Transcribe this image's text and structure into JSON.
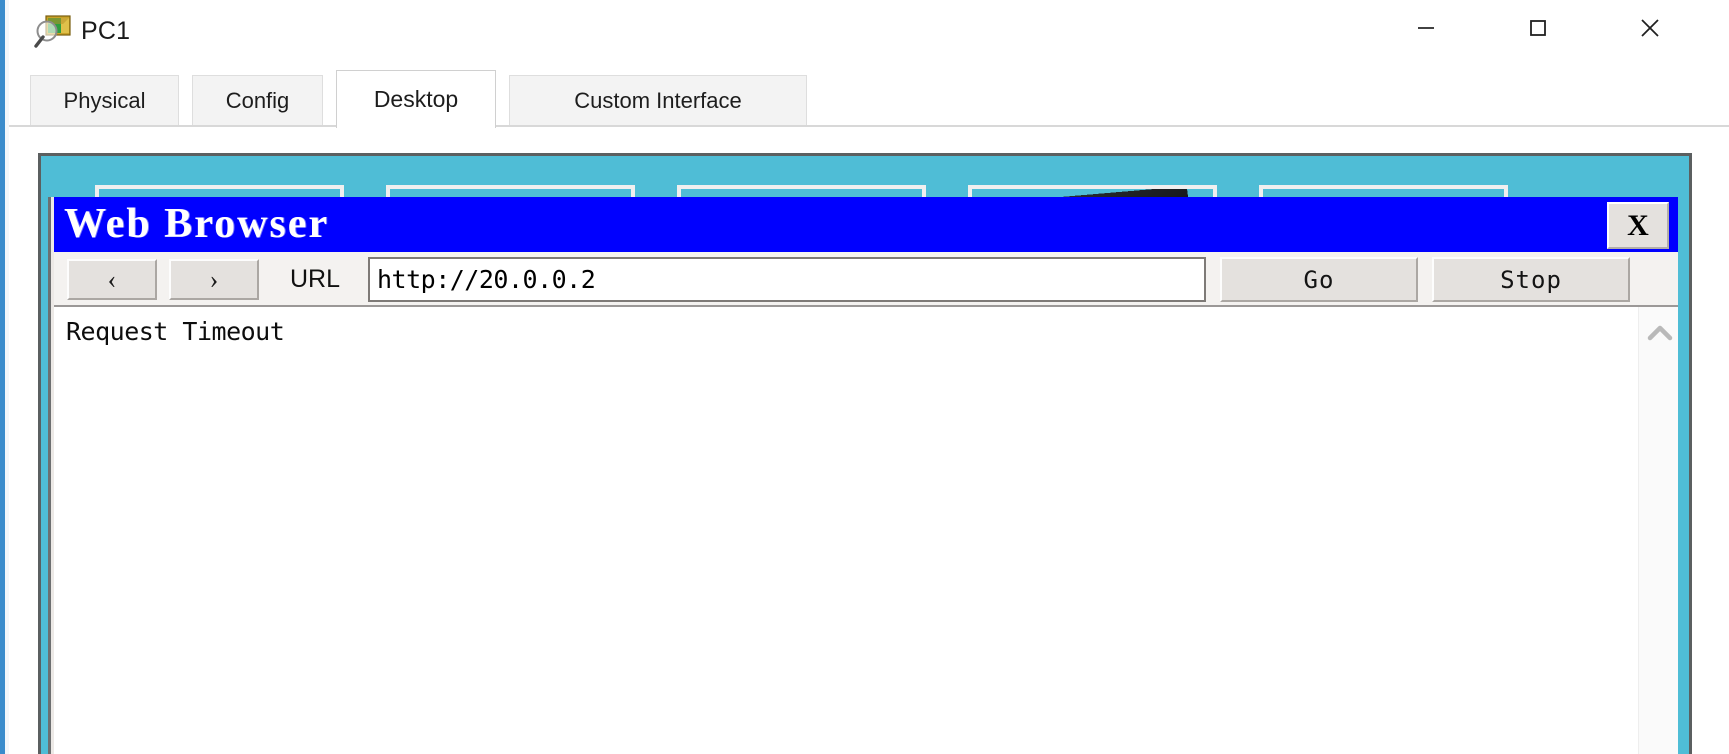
{
  "window": {
    "title": "PC1",
    "icon": "device-inspect-icon",
    "controls": {
      "minimize_label": "—",
      "minimize_icon": "minimize-icon",
      "maximize_label": "□",
      "maximize_icon": "maximize-icon",
      "close_label": "✕",
      "close_icon": "close-icon"
    }
  },
  "tabs": [
    {
      "label": "Physical",
      "active": false
    },
    {
      "label": "Config",
      "active": false
    },
    {
      "label": "Desktop",
      "active": true
    },
    {
      "label": "Custom Interface",
      "active": false
    }
  ],
  "desktop": {
    "background_color": "#4fbdd6",
    "tiles": [
      {
        "name": "desktop-tile-1"
      },
      {
        "name": "desktop-tile-2"
      },
      {
        "name": "desktop-tile-3"
      },
      {
        "name": "desktop-tile-4"
      },
      {
        "name": "desktop-tile-5"
      }
    ]
  },
  "browser": {
    "title": "Web Browser",
    "titlebar_color": "#0000ff",
    "close_label": "X",
    "toolbar": {
      "back_label": "‹",
      "forward_label": "›",
      "url_label": "URL",
      "url_value": "http://20.0.0.2",
      "url_placeholder": "",
      "go_label": "Go",
      "stop_label": "Stop"
    },
    "page": {
      "content": "Request Timeout"
    },
    "scrollbar": {
      "up_arrow_icon": "chevron-up-icon"
    }
  }
}
